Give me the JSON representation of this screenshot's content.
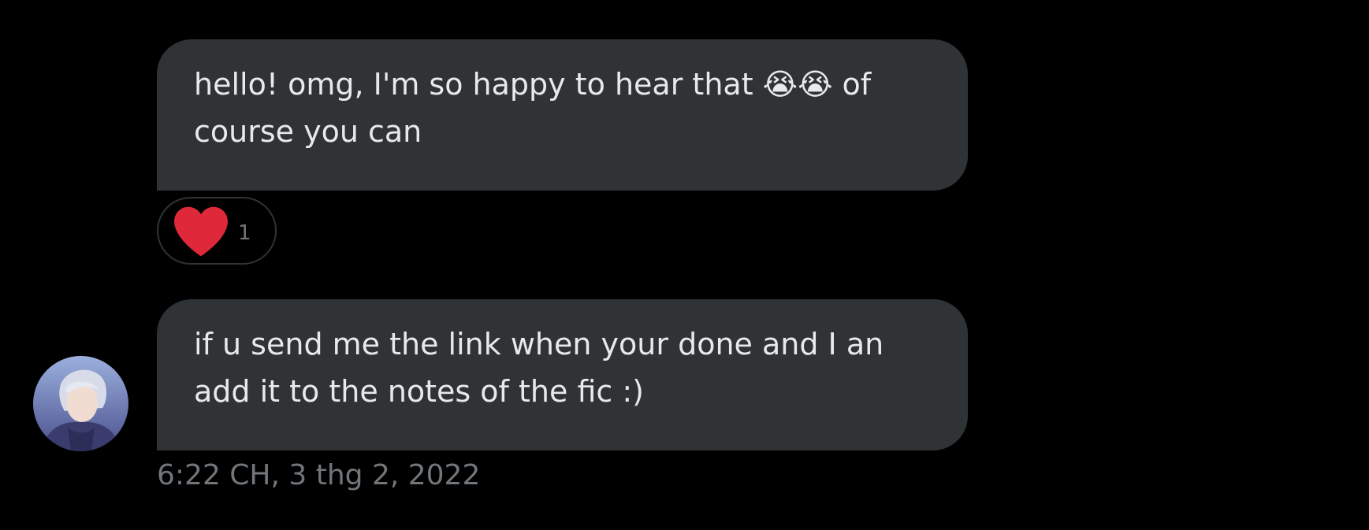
{
  "messages": [
    {
      "text": "hello! omg, I'm so happy to hear that 😭😭 of course you can"
    },
    {
      "text": "if u send me the link when your done and I  an add it to the notes of the fic :)"
    }
  ],
  "reaction": {
    "icon": "heart-icon",
    "count": "1",
    "color": "#e0283b"
  },
  "timestamp": "6:22 CH, 3 thg 2, 2022",
  "avatar": {
    "icon": "avatar-image"
  },
  "colors": {
    "background": "#000000",
    "bubble": "#2f3336",
    "text": "#e7e9ea",
    "muted": "#71767b"
  }
}
